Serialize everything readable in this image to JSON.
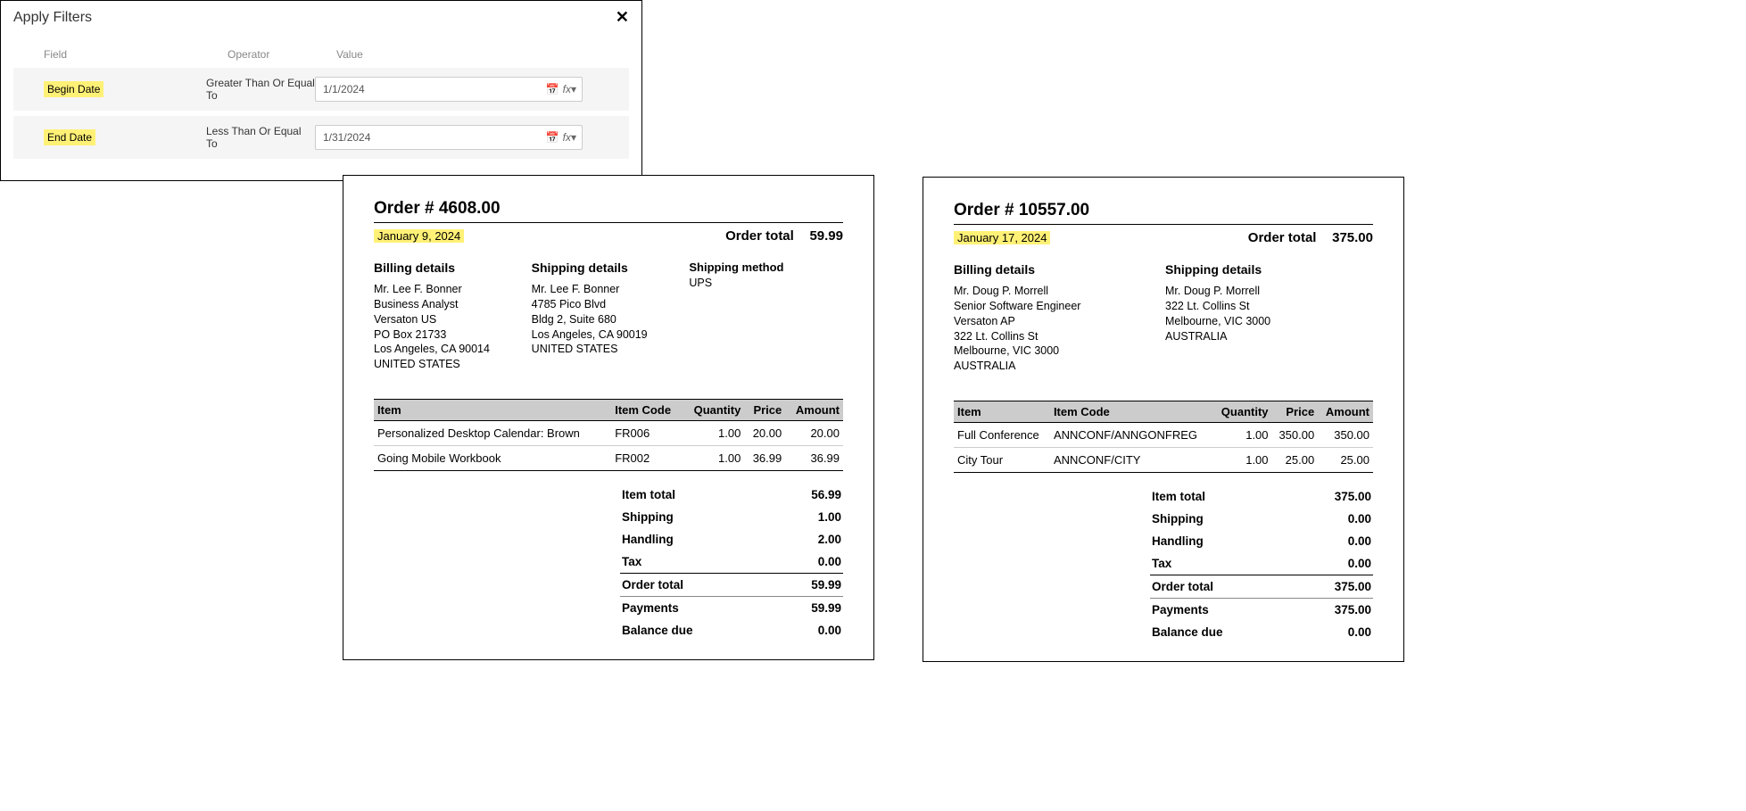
{
  "dialog": {
    "title": "Apply Filters",
    "columns": {
      "field": "Field",
      "operator": "Operator",
      "value": "Value"
    },
    "rows": [
      {
        "field": "Begin Date",
        "operator": "Greater Than Or Equal To",
        "value": "1/1/2024"
      },
      {
        "field": "End Date",
        "operator": "Less Than Or Equal To",
        "value": "1/31/2024"
      }
    ]
  },
  "orders": [
    {
      "title": "Order # 4608.00",
      "date": "January 9, 2024",
      "order_total_label": "Order total",
      "order_total": "59.99",
      "billing": {
        "heading": "Billing details",
        "lines": [
          "Mr. Lee F. Bonner",
          "Business Analyst",
          "Versaton US",
          "PO Box 21733",
          "Los Angeles, CA 90014",
          "UNITED STATES"
        ]
      },
      "shipping": {
        "heading": "Shipping details",
        "lines": [
          "Mr. Lee F. Bonner",
          "4785 Pico Blvd",
          "Bldg 2, Suite 680",
          "Los Angeles, CA 90019",
          "UNITED STATES"
        ]
      },
      "ship_method": {
        "heading": "Shipping method",
        "value": "UPS"
      },
      "table": {
        "headers": [
          "Item",
          "Item Code",
          "Quantity",
          "Price",
          "Amount"
        ],
        "rows": [
          [
            "Personalized Desktop Calendar: Brown",
            "FR006",
            "1.00",
            "20.00",
            "20.00"
          ],
          [
            "Going Mobile Workbook",
            "FR002",
            "1.00",
            "36.99",
            "36.99"
          ]
        ]
      },
      "totals": [
        {
          "label": "Item total",
          "value": "56.99",
          "bold": true
        },
        {
          "label": "Shipping",
          "value": "1.00",
          "bold": true
        },
        {
          "label": "Handling",
          "value": "2.00",
          "bold": true
        },
        {
          "label": "Tax",
          "value": "0.00",
          "bold": true
        },
        {
          "label": "Order total",
          "value": "59.99",
          "bold": true,
          "topline": true
        },
        {
          "label": "Payments",
          "value": "59.99",
          "bold": true,
          "thinline": true
        },
        {
          "label": "Balance due",
          "value": "0.00",
          "bold": true
        }
      ]
    },
    {
      "title": "Order # 10557.00",
      "date": "January 17, 2024",
      "order_total_label": "Order total",
      "order_total": "375.00",
      "billing": {
        "heading": "Billing details",
        "lines": [
          "Mr. Doug P. Morrell",
          "Senior Software Engineer",
          "Versaton AP",
          "322 Lt. Collins St",
          "Melbourne, VIC 3000",
          "AUSTRALIA"
        ]
      },
      "shipping": {
        "heading": "Shipping details",
        "lines": [
          "Mr. Doug P. Morrell",
          "322 Lt. Collins St",
          "Melbourne, VIC 3000",
          "AUSTRALIA"
        ]
      },
      "ship_method": null,
      "table": {
        "headers": [
          "Item",
          "Item Code",
          "Quantity",
          "Price",
          "Amount"
        ],
        "rows": [
          [
            "Full Conference",
            "ANNCONF/ANNGONFREG",
            "1.00",
            "350.00",
            "350.00"
          ],
          [
            "City Tour",
            "ANNCONF/CITY",
            "1.00",
            "25.00",
            "25.00"
          ]
        ]
      },
      "totals": [
        {
          "label": "Item total",
          "value": "375.00",
          "bold": true
        },
        {
          "label": "Shipping",
          "value": "0.00",
          "bold": true
        },
        {
          "label": "Handling",
          "value": "0.00",
          "bold": true
        },
        {
          "label": "Tax",
          "value": "0.00",
          "bold": true
        },
        {
          "label": "Order total",
          "value": "375.00",
          "bold": true,
          "topline": true
        },
        {
          "label": "Payments",
          "value": "375.00",
          "bold": true,
          "thinline": true
        },
        {
          "label": "Balance due",
          "value": "0.00",
          "bold": true
        }
      ]
    }
  ]
}
